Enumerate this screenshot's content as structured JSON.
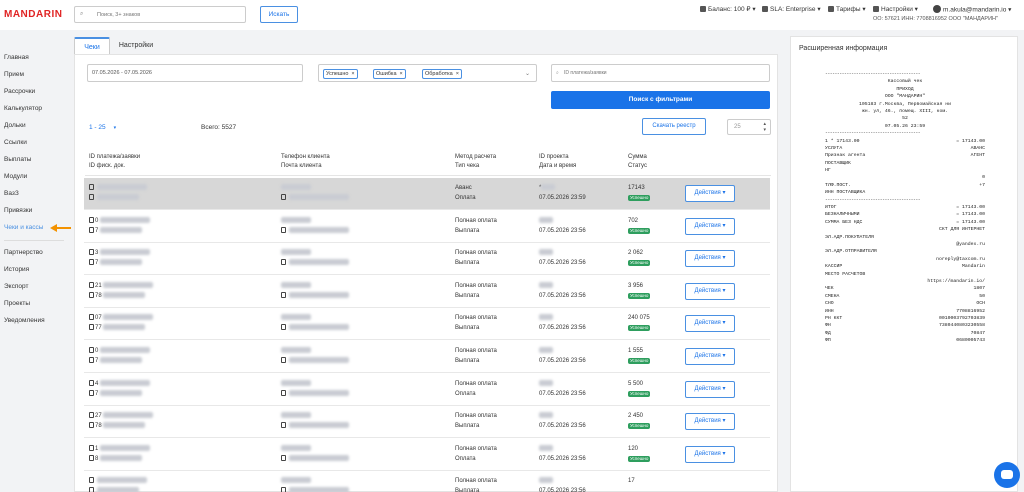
{
  "brand": {
    "name": "MANDARIN",
    "color": "#e02424"
  },
  "accent": "#1a73e8",
  "topbar": {
    "search_placeholder": "Поиск, 3+ знаков",
    "search_button": "Искать",
    "balance": "Баланс: 100 ₽",
    "sla": "SLA: Enterprise",
    "tariffs": "Тарифы",
    "settings": "Настройки",
    "user_email": "m.akula@mandarin.io",
    "company": "ОО: 57621  ИНН: 7708816952  ООО \"МАНДАРИН\""
  },
  "sidebar": {
    "items": [
      {
        "label": "Главная"
      },
      {
        "label": "Прием"
      },
      {
        "label": "Рассрочки"
      },
      {
        "label": "Калькулятор"
      },
      {
        "label": "Дольки"
      },
      {
        "label": "Ссылки"
      },
      {
        "label": "Выплаты"
      },
      {
        "label": "Модули"
      },
      {
        "label": "ВазЗ"
      },
      {
        "label": "Привязки"
      },
      {
        "label": "Чеки и кассы"
      },
      {
        "label": "Партнерство"
      },
      {
        "label": "История"
      },
      {
        "label": "Экспорт"
      },
      {
        "label": "Проекты"
      },
      {
        "label": "Уведомления"
      }
    ],
    "active_index": 10
  },
  "tabs": [
    {
      "label": "Чеки"
    },
    {
      "label": "Настройки"
    }
  ],
  "filters": {
    "date_range": "07.05.2026 - 07.05.2026",
    "status_chips": [
      {
        "label": "Успешно"
      },
      {
        "label": "Ошибка"
      },
      {
        "label": "Обработка"
      }
    ],
    "search_placeholder": "ID платежа/заявки",
    "filter_button": "Поиск с фильтрами"
  },
  "pagination": {
    "range": "1 - 25",
    "total": "Всего: 5527",
    "per_page": "25"
  },
  "registry_button": "Скачать реестр",
  "columns": [
    {
      "l1": "ID платежа/заявки",
      "l2": "ID фиск. док."
    },
    {
      "l1": "Телефон клиента",
      "l2": "Почта клиента"
    },
    {
      "l1": "Метод расчета",
      "l2": "Тип чека"
    },
    {
      "l1": "ID проекта",
      "l2": "Дата и время"
    },
    {
      "l1": "Сумма",
      "l2": "Статус"
    }
  ],
  "rows": [
    {
      "id1": "",
      "id2": "",
      "method": "Аванс",
      "type": "Оплата",
      "project": "*",
      "datetime": "07.05.2026 23:59",
      "amount": "17143",
      "status": "Успешно",
      "action": "Действия",
      "highlight": true
    },
    {
      "id1": "0",
      "id2": "7",
      "method": "Полная оплата",
      "type": "Выплата",
      "project": "",
      "datetime": "07.05.2026 23:56",
      "amount": "702",
      "status": "Успешно",
      "action": "Действия",
      "highlight": false
    },
    {
      "id1": "3",
      "id2": "7",
      "method": "Полная оплата",
      "type": "Выплата",
      "project": "",
      "datetime": "07.05.2026 23:56",
      "amount": "2 062",
      "status": "Успешно",
      "action": "Действия",
      "highlight": false
    },
    {
      "id1": "21",
      "id2": "78",
      "method": "Полная оплата",
      "type": "Выплата",
      "project": "",
      "datetime": "07.05.2026 23:56",
      "amount": "3 956",
      "status": "Успешно",
      "action": "Действия",
      "highlight": false
    },
    {
      "id1": "07",
      "id2": "77",
      "method": "Полная оплата",
      "type": "Выплата",
      "project": "",
      "datetime": "07.05.2026 23:56",
      "amount": "240 075",
      "status": "Успешно",
      "action": "Действия",
      "highlight": false
    },
    {
      "id1": "0",
      "id2": "7",
      "method": "Полная оплата",
      "type": "Выплата",
      "project": "",
      "datetime": "07.05.2026 23:56",
      "amount": "1 555",
      "status": "Успешно",
      "action": "Действия",
      "highlight": false
    },
    {
      "id1": "4",
      "id2": "7",
      "method": "Полная оплата",
      "type": "Оплата",
      "project": "",
      "datetime": "07.05.2026 23:56",
      "amount": "5 500",
      "status": "Успешно",
      "action": "Действия",
      "highlight": false
    },
    {
      "id1": "27",
      "id2": "78",
      "method": "Полная оплата",
      "type": "Выплата",
      "project": "",
      "datetime": "07.05.2026 23:56",
      "amount": "2 450",
      "status": "Успешно",
      "action": "Действия",
      "highlight": false
    },
    {
      "id1": "1",
      "id2": "8",
      "method": "Полная оплата",
      "type": "Оплата",
      "project": "",
      "datetime": "07.05.2026 23:56",
      "amount": "120",
      "status": "Успешно",
      "action": "Действия",
      "highlight": false
    },
    {
      "id1": "",
      "id2": "",
      "method": "Полная оплата",
      "type": "Выплата",
      "project": "",
      "datetime": "07.05.2026 23:56",
      "amount": "17",
      "status": "",
      "action": "",
      "highlight": false
    }
  ],
  "right_panel": {
    "title": "Расширенная информация",
    "receipt_lines": [
      {
        "t": "sep",
        "text": "----------------------------------------"
      },
      {
        "t": "c",
        "text": "Кассовый чек"
      },
      {
        "t": "c",
        "text": "ПРИХОД"
      },
      {
        "t": "c",
        "text": "ООО \"МАНДАРИН\""
      },
      {
        "t": "c",
        "text": "105183 г.Москва, Первомайская ни"
      },
      {
        "t": "c",
        "text": "жн. ул, 46., помещ. XIII, ком."
      },
      {
        "t": "c",
        "text": "52"
      },
      {
        "t": "c",
        "text": "07.05.26 23:59"
      },
      {
        "t": "sep",
        "text": "----------------------------------------"
      },
      {
        "t": "lr",
        "l": "1 * 17143.00",
        "r": "= 17143.00"
      },
      {
        "t": "lr",
        "l": "УСЛУГА",
        "r": "АВАНС"
      },
      {
        "t": "lr",
        "l": "Признак агента",
        "r": "АГЕНТ"
      },
      {
        "t": "lr",
        "l": "ПОСТАВЩИК",
        "r": ""
      },
      {
        "t": "lr",
        "l": "НГ",
        "r": ""
      },
      {
        "t": "lr",
        "l": "",
        "r": "0"
      },
      {
        "t": "lr",
        "l": "ТЛФ.ПОСТ.",
        "r": "+7"
      },
      {
        "t": "lr",
        "l": "ИНН ПОСТАВЩИКА",
        "r": ""
      },
      {
        "t": "sep",
        "text": "----------------------------------------"
      },
      {
        "t": "lr",
        "l": "ИТОГ",
        "r": "= 17143.00"
      },
      {
        "t": "lr",
        "l": "БЕЗНАЛИЧНЫМИ",
        "r": "= 17143.00"
      },
      {
        "t": "lr",
        "l": "СУММА БЕЗ НДС",
        "r": "= 17143.00"
      },
      {
        "t": "lr",
        "l": "",
        "r": "СКТ ДЛЯ ИНТЕРНЕТ"
      },
      {
        "t": "lr",
        "l": "ЭЛ.АДР.ПОКУПАТЕЛЯ",
        "r": ""
      },
      {
        "t": "lr",
        "l": "",
        "r": "@yandex.ru"
      },
      {
        "t": "lr",
        "l": "ЭЛ.АДР.ОТПРАВИТЕЛЯ",
        "r": ""
      },
      {
        "t": "lr",
        "l": "",
        "r": "noreply@taxcom.ru"
      },
      {
        "t": "lr",
        "l": "КАССИР",
        "r": "Mandarin"
      },
      {
        "t": "lr",
        "l": "МЕСТО РАСЧЕТОВ",
        "r": ""
      },
      {
        "t": "lr",
        "l": "",
        "r": "https://mandarin.io/"
      },
      {
        "t": "lr",
        "l": "ЧЕК",
        "r": "1807"
      },
      {
        "t": "lr",
        "l": "СМЕНА",
        "r": "50"
      },
      {
        "t": "lr",
        "l": "СНО",
        "r": "ОСН"
      },
      {
        "t": "lr",
        "l": "ИНН",
        "r": "7708816952"
      },
      {
        "t": "lr",
        "l": "РН ККТ",
        "r": "0010003792703839"
      },
      {
        "t": "lr",
        "l": "ФН",
        "r": "7380440803230558"
      },
      {
        "t": "lr",
        "l": "ФД",
        "r": "70847"
      },
      {
        "t": "lr",
        "l": "ФП",
        "r": "0680005743"
      }
    ]
  },
  "status_color": "#2e9e5e"
}
